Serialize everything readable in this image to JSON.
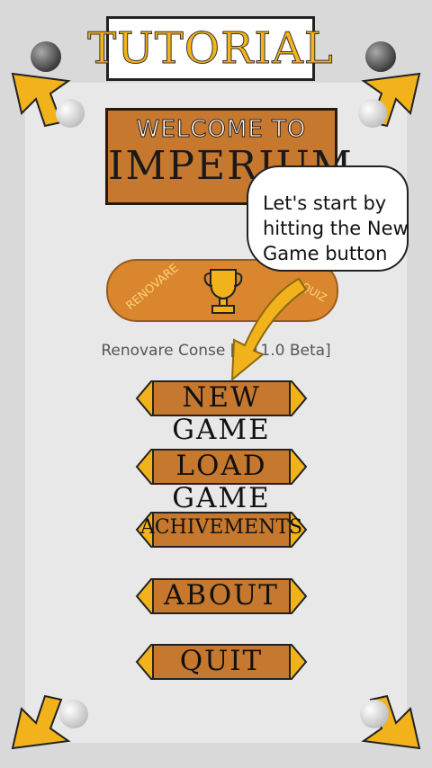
{
  "tutorial": {
    "title": "TUTORIAL"
  },
  "logo": {
    "line1": "WELCOME TO",
    "line2": "IMPERIUM"
  },
  "badge": {
    "left_text": "RENOVARE",
    "right_text": "QUIZ"
  },
  "version_text": "Renovare Conse        [0.11.0 Beta]",
  "tooltip": {
    "text": "Let's start by hitting the New Game button"
  },
  "menu": [
    {
      "label": "NEW GAME"
    },
    {
      "label": "LOAD GAME"
    },
    {
      "label": "ACHIVEMENTS"
    },
    {
      "label": "ABOUT"
    },
    {
      "label": "QUIT"
    }
  ],
  "colors": {
    "accent": "#f6b31a",
    "wood": "#c6782f",
    "arrow": "#f2b21c"
  },
  "icons": [
    "corner-arrow-icon",
    "pin-icon",
    "trophy-icon",
    "pointer-arrow-icon"
  ]
}
